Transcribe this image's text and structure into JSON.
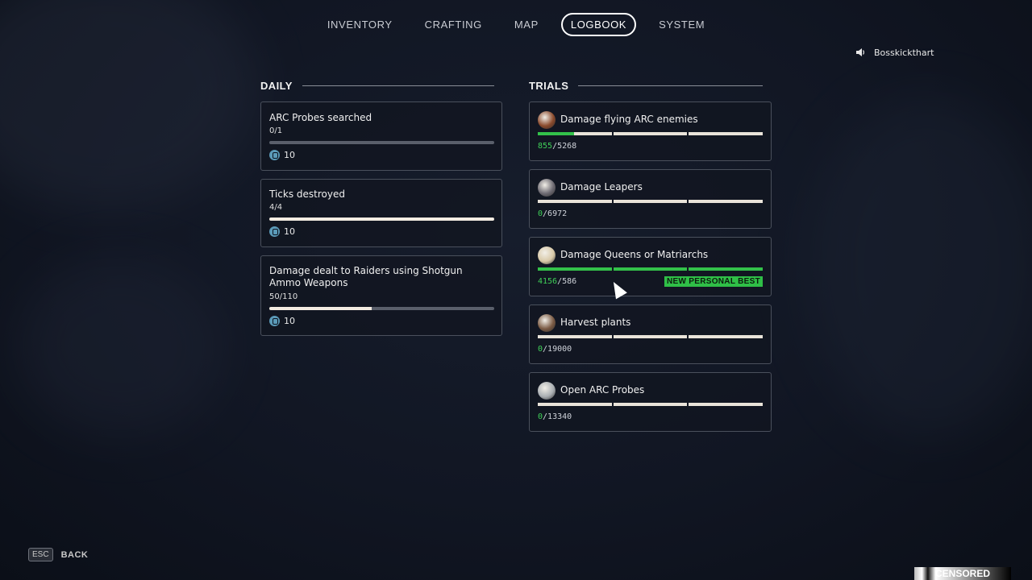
{
  "nav": {
    "tabs": [
      {
        "label": "INVENTORY",
        "active": false
      },
      {
        "label": "CRAFTING",
        "active": false
      },
      {
        "label": "MAP",
        "active": false
      },
      {
        "label": "LOGBOOK",
        "active": true
      },
      {
        "label": "SYSTEM",
        "active": false
      }
    ]
  },
  "user": {
    "name": "Bosskickthart",
    "icon": "speaker-icon"
  },
  "daily": {
    "heading": "DAILY",
    "items": [
      {
        "title": "ARC Probes searched",
        "progress": "0/1",
        "fraction": 0.0,
        "reward": "10",
        "reward_icon": "coin-icon"
      },
      {
        "title": "Ticks destroyed",
        "progress": "4/4",
        "fraction": 1.0,
        "reward": "10",
        "reward_icon": "coin-icon"
      },
      {
        "title": "Damage dealt to Raiders using Shotgun Ammo Weapons",
        "progress": "50/110",
        "fraction": 0.4545,
        "reward": "10",
        "reward_icon": "coin-icon"
      }
    ]
  },
  "trials": {
    "heading": "TRIALS",
    "items": [
      {
        "title": "Damage flying ARC enemies",
        "current": "855",
        "total": "/5268",
        "fraction": 0.162,
        "icon": "flying-arc-icon",
        "icon_color": "#8a4a2c"
      },
      {
        "title": "Damage Leapers",
        "current": "0",
        "total": "/6972",
        "fraction": 0.0,
        "icon": "leaper-icon",
        "icon_color": "#6d6a72"
      },
      {
        "title": "Damage Queens or Matriarchs",
        "current": "4156",
        "total": "/586",
        "fraction": 1.0,
        "icon": "queen-icon",
        "icon_color": "#d8c9a8",
        "badge": "NEW PERSONAL BEST"
      },
      {
        "title": "Harvest plants",
        "current": "0",
        "total": "/19000",
        "fraction": 0.0,
        "icon": "plant-icon",
        "icon_color": "#7a5a44"
      },
      {
        "title": "Open ARC Probes",
        "current": "0",
        "total": "/13340",
        "fraction": 0.0,
        "icon": "probe-icon",
        "icon_color": "#a9aeb2"
      }
    ]
  },
  "footer": {
    "esc_key": "ESC",
    "back_label": "BACK"
  },
  "watermark": {
    "text": "CENSORED"
  },
  "colors": {
    "accent_green": "#33c24a",
    "bar_light": "#f3ece2",
    "bar_dark": "#5a5f6b"
  }
}
